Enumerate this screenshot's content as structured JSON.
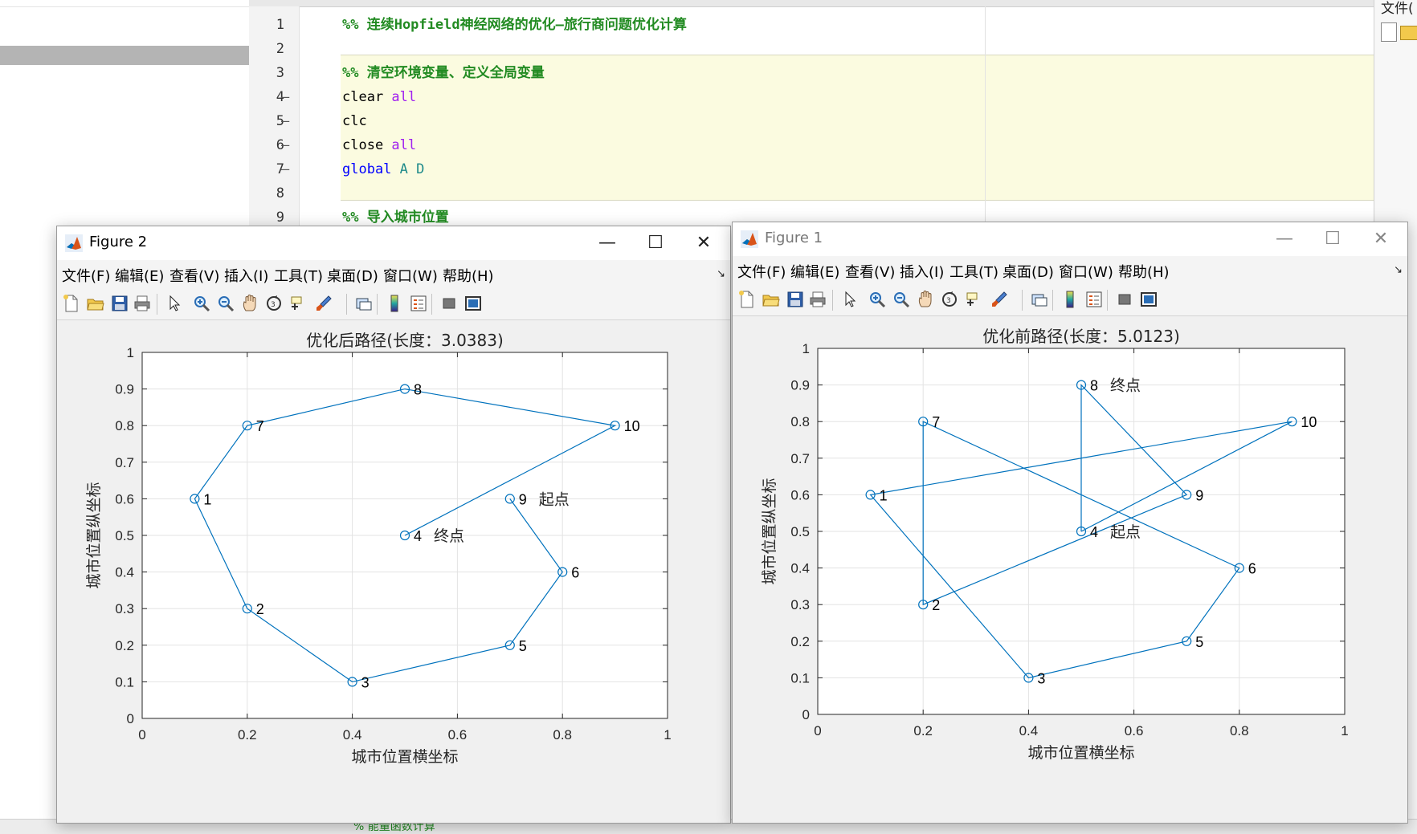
{
  "editor": {
    "lines": [
      {
        "num": "1",
        "dash": "",
        "parts": [
          {
            "cls": "cm",
            "t": "%% 连续Hopfield神经网络的优化—旅行商问题优化计算"
          }
        ]
      },
      {
        "num": "2",
        "dash": "",
        "parts": []
      },
      {
        "num": "3",
        "dash": "",
        "parts": [
          {
            "cls": "cm",
            "t": "%% 清空环境变量、定义全局变量"
          }
        ]
      },
      {
        "num": "4",
        "dash": "—",
        "parts": [
          {
            "cls": "pl",
            "t": "clear "
          },
          {
            "cls": "str",
            "t": "all"
          }
        ]
      },
      {
        "num": "5",
        "dash": "—",
        "parts": [
          {
            "cls": "pl",
            "t": "clc"
          }
        ]
      },
      {
        "num": "6",
        "dash": "—",
        "parts": [
          {
            "cls": "pl",
            "t": "close "
          },
          {
            "cls": "str",
            "t": "all"
          }
        ]
      },
      {
        "num": "7",
        "dash": "—",
        "parts": [
          {
            "cls": "kw",
            "t": "global"
          },
          {
            "cls": "pl",
            "t": " "
          },
          {
            "cls": "glob",
            "t": "A D"
          }
        ]
      },
      {
        "num": "8",
        "dash": "",
        "parts": []
      },
      {
        "num": "9",
        "dash": "",
        "parts": [
          {
            "cls": "cm",
            "t": "%% 导入城市位置"
          }
        ]
      }
    ],
    "right_strip_text": "文件(",
    "bottom_comment": "% 能量函数计算"
  },
  "menus": [
    "文件(F)",
    "编辑(E)",
    "查看(V)",
    "插入(I)",
    "工具(T)",
    "桌面(D)",
    "窗口(W)",
    "帮助(H)"
  ],
  "icons": {
    "toolbar": [
      "new-file-icon",
      "open-folder-icon",
      "save-icon",
      "print-icon",
      "pointer-icon",
      "zoom-in-icon",
      "zoom-out-icon",
      "pan-hand-icon",
      "rotate-3d-icon",
      "data-cursor-icon",
      "brush-icon",
      "link-plot-icon",
      "colorbar-icon",
      "legend-icon",
      "hide-plot-tools-icon",
      "show-plot-tools-icon"
    ],
    "window": [
      "minimize-icon",
      "maximize-icon",
      "close-icon"
    ]
  },
  "colors": {
    "line": "#0072bd",
    "accent_matlab": "#d9541a"
  },
  "windows": [
    {
      "id": "fig2",
      "title": "Figure 2",
      "active": true,
      "axes_title": "优化后路径(长度：3.0383)",
      "xlabel": "城市位置横坐标",
      "ylabel": "城市位置纵坐标"
    },
    {
      "id": "fig1",
      "title": "Figure 1",
      "active": false,
      "axes_title": "优化前路径(长度：5.0123)",
      "xlabel": "城市位置横坐标",
      "ylabel": "城市位置纵坐标"
    }
  ],
  "chart_data": [
    {
      "type": "line",
      "title": "优化后路径(长度：3.0383)",
      "xlabel": "城市位置横坐标",
      "ylabel": "城市位置纵坐标",
      "xlim": [
        0,
        1
      ],
      "ylim": [
        0,
        1
      ],
      "xticks": [
        "0",
        "0.2",
        "0.4",
        "0.6",
        "0.8",
        "1"
      ],
      "yticks": [
        "0",
        "0.1",
        "0.2",
        "0.3",
        "0.4",
        "0.5",
        "0.6",
        "0.7",
        "0.8",
        "0.9",
        "1"
      ],
      "grid": true,
      "marker": "circle",
      "path_order": [
        9,
        6,
        5,
        3,
        2,
        1,
        7,
        8,
        10,
        4
      ],
      "cities": [
        {
          "id": 1,
          "label": "1",
          "x": 0.1,
          "y": 0.6
        },
        {
          "id": 2,
          "label": "2",
          "x": 0.2,
          "y": 0.3
        },
        {
          "id": 3,
          "label": "3",
          "x": 0.4,
          "y": 0.1
        },
        {
          "id": 4,
          "label": "4",
          "x": 0.5,
          "y": 0.5
        },
        {
          "id": 5,
          "label": "5",
          "x": 0.7,
          "y": 0.2
        },
        {
          "id": 6,
          "label": "6",
          "x": 0.8,
          "y": 0.4
        },
        {
          "id": 7,
          "label": "7",
          "x": 0.2,
          "y": 0.8
        },
        {
          "id": 8,
          "label": "8",
          "x": 0.5,
          "y": 0.9
        },
        {
          "id": 9,
          "label": "9",
          "x": 0.7,
          "y": 0.6
        },
        {
          "id": 10,
          "label": "10",
          "x": 0.9,
          "y": 0.8
        }
      ],
      "annotations": [
        {
          "city": 9,
          "text": "起点"
        },
        {
          "city": 4,
          "text": "终点"
        }
      ]
    },
    {
      "type": "line",
      "title": "优化前路径(长度：5.0123)",
      "xlabel": "城市位置横坐标",
      "ylabel": "城市位置纵坐标",
      "xlim": [
        0,
        1
      ],
      "ylim": [
        0,
        1
      ],
      "xticks": [
        "0",
        "0.2",
        "0.4",
        "0.6",
        "0.8",
        "1"
      ],
      "yticks": [
        "0",
        "0.1",
        "0.2",
        "0.3",
        "0.4",
        "0.5",
        "0.6",
        "0.7",
        "0.8",
        "0.9",
        "1"
      ],
      "grid": true,
      "marker": "circle",
      "path_order": [
        4,
        8,
        9,
        2,
        7,
        6,
        5,
        3,
        1,
        10,
        4
      ],
      "cities": [
        {
          "id": 1,
          "label": "1",
          "x": 0.1,
          "y": 0.6
        },
        {
          "id": 2,
          "label": "2",
          "x": 0.2,
          "y": 0.3
        },
        {
          "id": 3,
          "label": "3",
          "x": 0.4,
          "y": 0.1
        },
        {
          "id": 4,
          "label": "4",
          "x": 0.5,
          "y": 0.5
        },
        {
          "id": 5,
          "label": "5",
          "x": 0.7,
          "y": 0.2
        },
        {
          "id": 6,
          "label": "6",
          "x": 0.8,
          "y": 0.4
        },
        {
          "id": 7,
          "label": "7",
          "x": 0.2,
          "y": 0.8
        },
        {
          "id": 8,
          "label": "8",
          "x": 0.5,
          "y": 0.9
        },
        {
          "id": 9,
          "label": "9",
          "x": 0.7,
          "y": 0.6
        },
        {
          "id": 10,
          "label": "10",
          "x": 0.9,
          "y": 0.8
        }
      ],
      "annotations": [
        {
          "city": 8,
          "text": "终点"
        },
        {
          "city": 4,
          "text": "起点"
        }
      ]
    }
  ]
}
